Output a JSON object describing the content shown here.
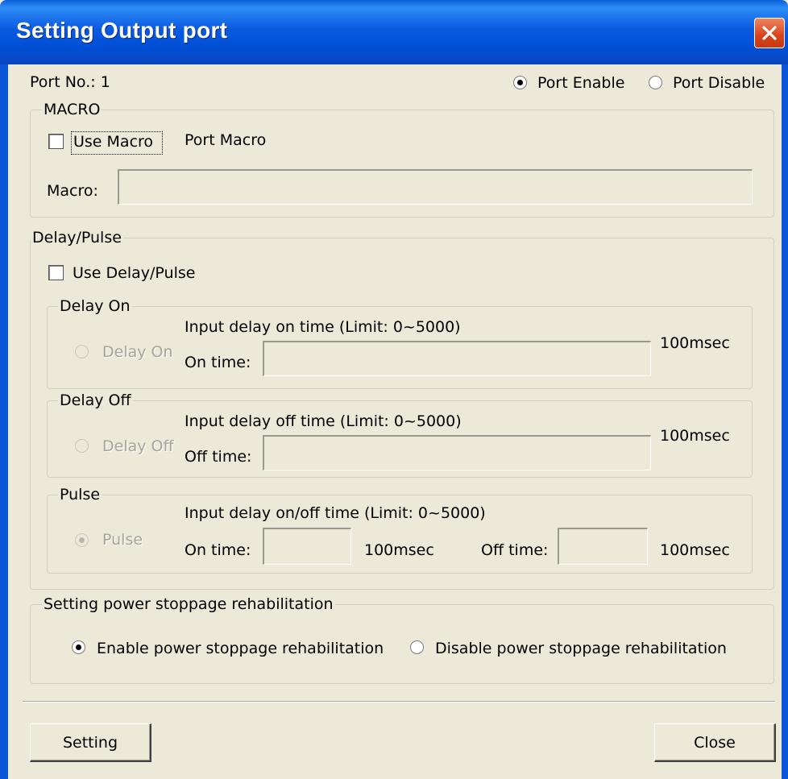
{
  "window": {
    "title": "Setting Output port"
  },
  "port": {
    "label": "Port No.: 1",
    "enable_label": "Port Enable",
    "disable_label": "Port Disable",
    "selected": "enable"
  },
  "macro": {
    "group_label": "MACRO",
    "use_macro_label": "Use Macro",
    "use_macro_checked": false,
    "port_macro_label": "Port Macro",
    "macro_field_label": "Macro:",
    "macro_value": ""
  },
  "delay_pulse": {
    "group_label": "Delay/Pulse",
    "use_label": "Use Delay/Pulse",
    "use_checked": false,
    "delay_on": {
      "group_label": "Delay On",
      "radio_label": "Delay On",
      "hint": "Input delay on time (Limit: 0~5000)",
      "time_label": "On time:",
      "time_value": "",
      "unit": "100msec"
    },
    "delay_off": {
      "group_label": "Delay Off",
      "radio_label": "Delay Off",
      "hint": "Input delay off time (Limit: 0~5000)",
      "time_label": "Off time:",
      "time_value": "",
      "unit": "100msec"
    },
    "pulse": {
      "group_label": "Pulse",
      "radio_label": "Pulse",
      "hint": "Input delay on/off time (Limit: 0~5000)",
      "on_label": "On time:",
      "on_value": "",
      "on_unit": "100msec",
      "off_label": "Off time:",
      "off_value": "",
      "off_unit": "100msec"
    },
    "selected": "pulse"
  },
  "power": {
    "group_label": "Setting power stoppage rehabilitation",
    "enable_label": "Enable power stoppage rehabilitation",
    "disable_label": "Disable power stoppage rehabilitation",
    "selected": "enable"
  },
  "buttons": {
    "setting": "Setting",
    "close": "Close"
  }
}
